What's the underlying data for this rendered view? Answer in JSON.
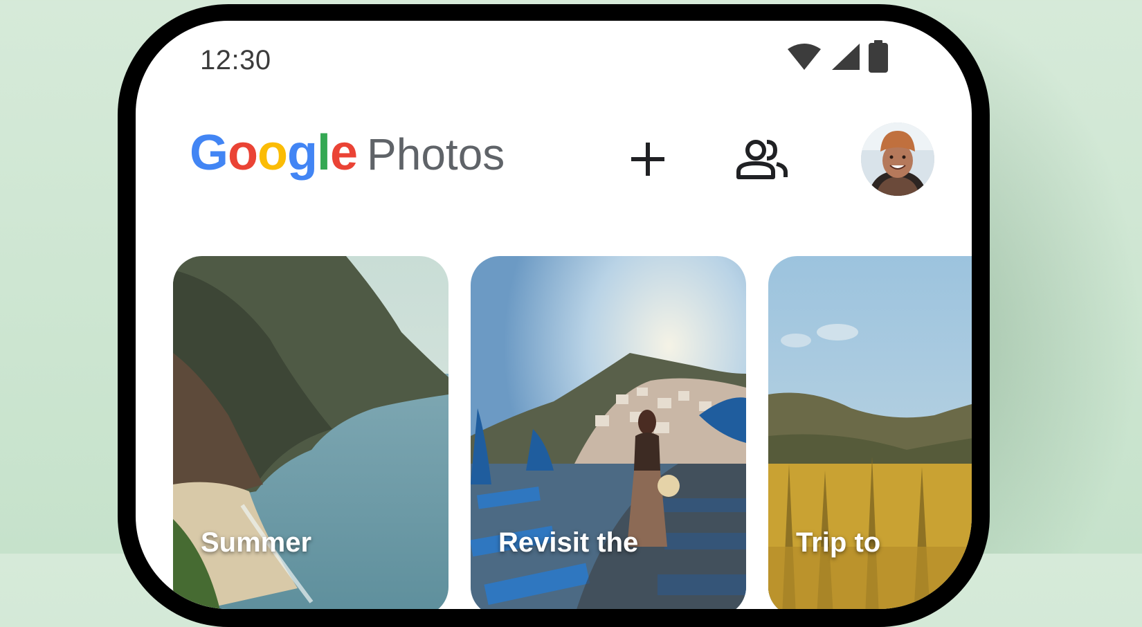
{
  "status_bar": {
    "time": "12:30",
    "icons": [
      "wifi-icon",
      "cellular-signal-icon",
      "battery-icon"
    ]
  },
  "header": {
    "logo_letters": [
      {
        "char": "G",
        "color": "#4285F4"
      },
      {
        "char": "o",
        "color": "#EA4335"
      },
      {
        "char": "o",
        "color": "#FBBC05"
      },
      {
        "char": "g",
        "color": "#4285F4"
      },
      {
        "char": "l",
        "color": "#34A853"
      },
      {
        "char": "e",
        "color": "#EA4335"
      }
    ],
    "logo_product": "Photos",
    "actions": [
      "add-icon",
      "people-sharing-icon",
      "avatar"
    ]
  },
  "memories": [
    {
      "title": "Summer"
    },
    {
      "title": "Revisit the"
    },
    {
      "title": "Trip to"
    }
  ],
  "colors": {
    "background": "#d0e8d4",
    "phone_frame": "#000000",
    "screen": "#ffffff",
    "icon_dark": "#202124",
    "logo_gray": "#5f6368"
  }
}
